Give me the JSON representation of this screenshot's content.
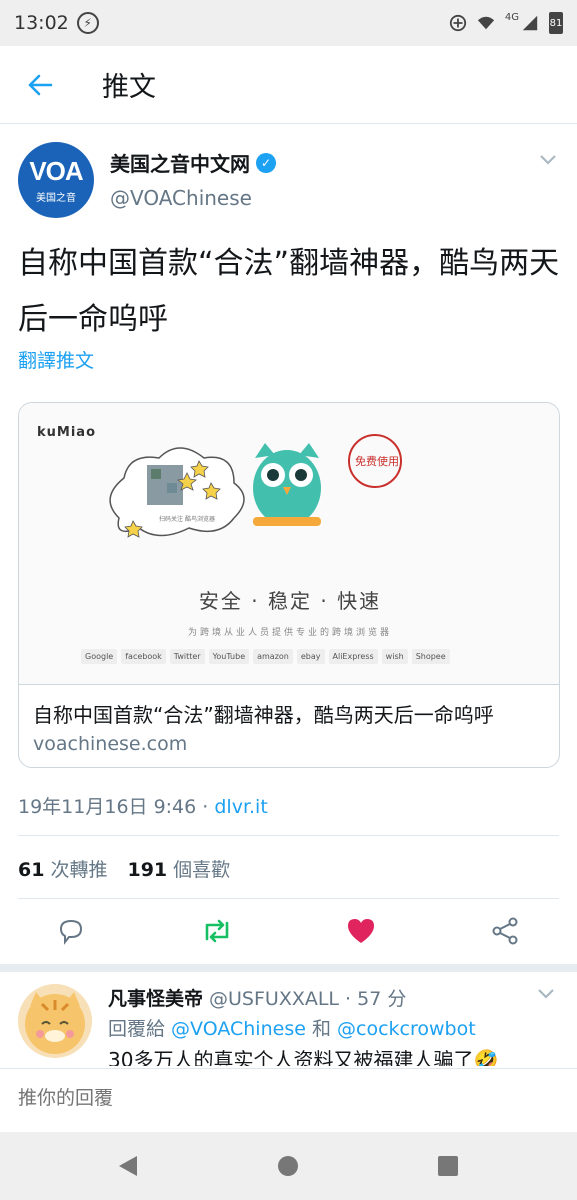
{
  "status_bar": {
    "time": "13:02",
    "network": "4G",
    "battery": "81"
  },
  "header": {
    "title": "推文"
  },
  "tweet": {
    "author_name": "美国之音中文网",
    "author_handle": "@VOAChinese",
    "avatar_text": "VOA",
    "avatar_sub": "美国之音",
    "text": "自称中国首款“合法”翻墙神器，酷鸟两天后一命呜呼",
    "translate_link": "翻譯推文",
    "card": {
      "brand_logo": "kuMiao",
      "slogan": "安全 · 稳定 · 快速",
      "sub_slogan": "为跨境从业人员提供专业的跨境浏览器",
      "brands": [
        "Google",
        "facebook",
        "Twitter",
        "YouTube",
        "amazon",
        "ebay",
        "AliExpress",
        "wish",
        "Shopee"
      ],
      "stamp_text": "免费使用",
      "title": "自称中国首款“合法”翻墙神器，酷鸟两天后一命呜呼",
      "domain": "voachinese.com"
    },
    "timestamp": "19年11月16日 9:46 · ",
    "source": "dlvr.it",
    "retweets_count": "61",
    "retweets_label": "次轉推",
    "likes_count": "191",
    "likes_label": "個喜歡"
  },
  "reply": {
    "name": "凡事怪美帝",
    "handle_time": "@USFUXXALL · 57 分",
    "reply_to_prefix": "回覆給 ",
    "mention1": "@VOAChinese",
    "conj": " 和 ",
    "mention2": "@cockcrowbot",
    "text": "30多万人的真实个人资料又被福建人骗了🤣"
  },
  "compose": {
    "placeholder": "推你的回覆"
  },
  "colors": {
    "accent": "#1da1f2",
    "like": "#e0245e",
    "retweet": "#17bf63",
    "muted": "#657786"
  },
  "icons": [
    "back-arrow-icon",
    "verified-icon",
    "chevron-down-icon",
    "reply-icon",
    "retweet-icon",
    "heart-icon",
    "share-icon",
    "nav-back-icon",
    "nav-home-icon",
    "nav-recents-icon"
  ]
}
